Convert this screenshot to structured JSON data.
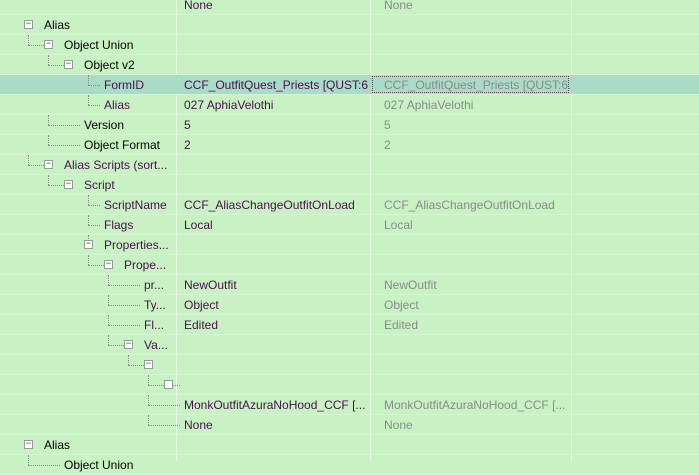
{
  "rows": [
    {
      "label": "",
      "v1": "None",
      "v2": "None"
    },
    {
      "label": "Alias",
      "v1": "",
      "v2": ""
    },
    {
      "label": "Object Union",
      "v1": "",
      "v2": ""
    },
    {
      "label": "Object v2",
      "v1": "",
      "v2": ""
    },
    {
      "label": "FormID",
      "v1": "CCF_OutfitQuest_Priests [QUST:6...",
      "v2": "CCF_OutfitQuest_Priests [QUST:6..."
    },
    {
      "label": "Alias",
      "v1": "027 AphiaVelothi",
      "v2": "027 AphiaVelothi"
    },
    {
      "label": "Version",
      "v1": "5",
      "v2": "5"
    },
    {
      "label": "Object Format",
      "v1": "2",
      "v2": "2"
    },
    {
      "label": "Alias Scripts (sort...",
      "v1": "",
      "v2": ""
    },
    {
      "label": "Script",
      "v1": "",
      "v2": ""
    },
    {
      "label": "ScriptName",
      "v1": "CCF_AliasChangeOutfitOnLoad",
      "v2": "CCF_AliasChangeOutfitOnLoad"
    },
    {
      "label": "Flags",
      "v1": "Local",
      "v2": "Local"
    },
    {
      "label": "Properties...",
      "v1": "",
      "v2": ""
    },
    {
      "label": "Prope...",
      "v1": "",
      "v2": ""
    },
    {
      "label": "pr...",
      "v1": "NewOutfit",
      "v2": "NewOutfit"
    },
    {
      "label": "Ty...",
      "v1": "Object",
      "v2": "Object"
    },
    {
      "label": "Fl...",
      "v1": "Edited",
      "v2": "Edited"
    },
    {
      "label": "Va...",
      "v1": "",
      "v2": ""
    },
    {
      "label": "",
      "v1": "",
      "v2": ""
    },
    {
      "label": "",
      "v1": "",
      "v2": ""
    },
    {
      "label": "",
      "v1": "MonkOutfitAzuraNoHood_CCF [...",
      "v2": "MonkOutfitAzuraNoHood_CCF [..."
    },
    {
      "label": "",
      "v1": "None",
      "v2": "None"
    },
    {
      "label": "Alias",
      "v1": "",
      "v2": ""
    },
    {
      "label": "Object Union",
      "v1": "",
      "v2": ""
    }
  ],
  "colors": {
    "background": "#c9f2c4",
    "selected_row": "#a8dcc6",
    "value_text": "#4a0e4e",
    "compare_text": "#8a8a8a"
  },
  "icons": {
    "expander": "minus-box-icon"
  },
  "expander_glyph": "−"
}
